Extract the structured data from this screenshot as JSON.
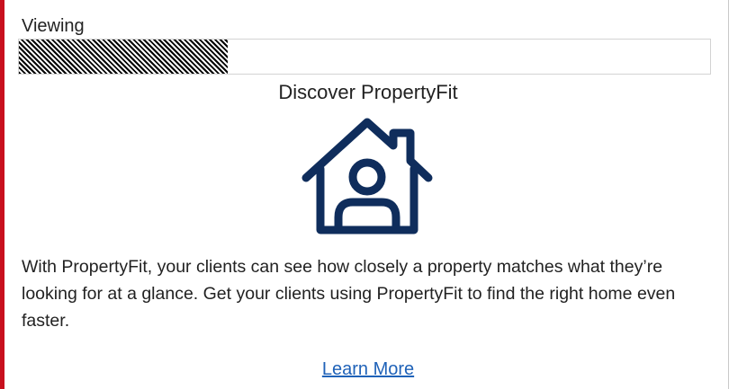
{
  "viewing": {
    "label": "Viewing"
  },
  "promo": {
    "title": "Discover PropertyFit",
    "icon": "house-with-person-icon",
    "body": "With PropertyFit, your clients can see how closely a property matches what they’re looking for at a glance. Get your clients using PropertyFit to find the right home even faster.",
    "link_label": "Learn More"
  },
  "colors": {
    "accent": "#c8101e",
    "icon": "#0f2d5c",
    "link": "#1f62b8"
  }
}
